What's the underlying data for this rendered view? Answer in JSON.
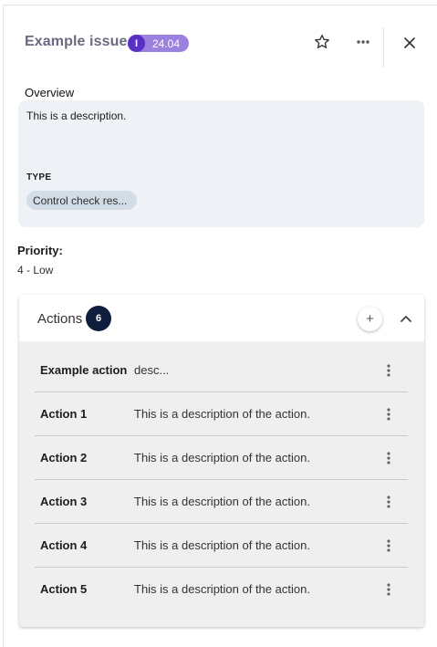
{
  "header": {
    "title": "Example issue",
    "badge_icon": "I",
    "badge_version": "24.04",
    "star_icon": "star-outline-icon",
    "more_icon": "more-horizontal-icon",
    "close_icon": "close-icon"
  },
  "overview": {
    "label": "Overview",
    "description": "This is a description.",
    "type_label": "TYPE",
    "type_value": "Control check res..."
  },
  "priority": {
    "label": "Priority:",
    "value": "4 - Low"
  },
  "actions": {
    "title": "Actions",
    "count": "6",
    "add_label": "+",
    "rows": [
      {
        "name": "Example action",
        "description": "desc..."
      },
      {
        "name": "Action 1",
        "description": "This is a description of the action."
      },
      {
        "name": "Action 2",
        "description": "This is a description of the action."
      },
      {
        "name": "Action 3",
        "description": "This is a description of the action."
      },
      {
        "name": "Action 4",
        "description": "This is a description of the action."
      },
      {
        "name": "Action 5",
        "description": "This is a description of the action."
      }
    ]
  },
  "colors": {
    "badge_bg": "#9b80e0",
    "badge_icon_bg": "#5a2fc4",
    "count_badge_bg": "#0e1e3c",
    "overview_bg": "#eef1f5",
    "chip_bg": "#d3dde7",
    "actions_body_bg": "#efefef"
  }
}
